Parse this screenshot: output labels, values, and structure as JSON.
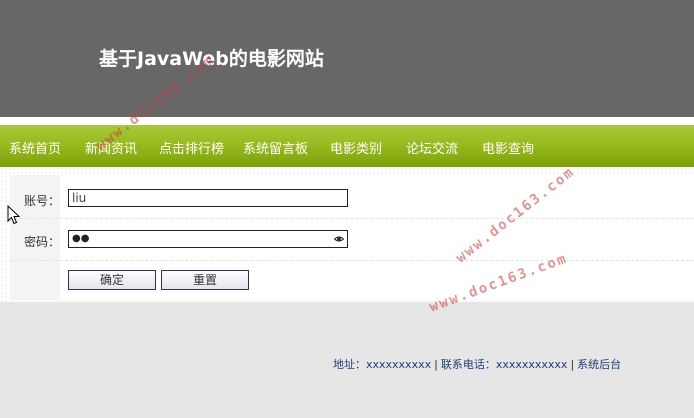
{
  "header": {
    "site_title": "基于JavaWeb的电影网站"
  },
  "nav": {
    "items": [
      {
        "label": "系统首页"
      },
      {
        "label": "新闻资讯"
      },
      {
        "label": "点击排行榜"
      },
      {
        "label": "系统留言板"
      },
      {
        "label": "电影类别"
      },
      {
        "label": "论坛交流"
      },
      {
        "label": "电影查询"
      }
    ]
  },
  "login_form": {
    "account_label": "账号：",
    "account_value": "liu",
    "password_label": "密码：",
    "password_masked": "●●",
    "confirm_label": "确定",
    "reset_label": "重置"
  },
  "footer": {
    "address": "地址：xxxxxxxxxx",
    "phone": "联系电话：xxxxxxxxxxx",
    "admin_link": "系统后台",
    "separator": "|"
  },
  "watermarks": [
    "www.doc163.com",
    "www.doc163.com",
    "www.doc163.com"
  ],
  "colors": {
    "header_bg": "#676767",
    "nav_green": "#98bb1f",
    "footer_link": "#1f3f77",
    "watermark": "#c83c3c"
  }
}
